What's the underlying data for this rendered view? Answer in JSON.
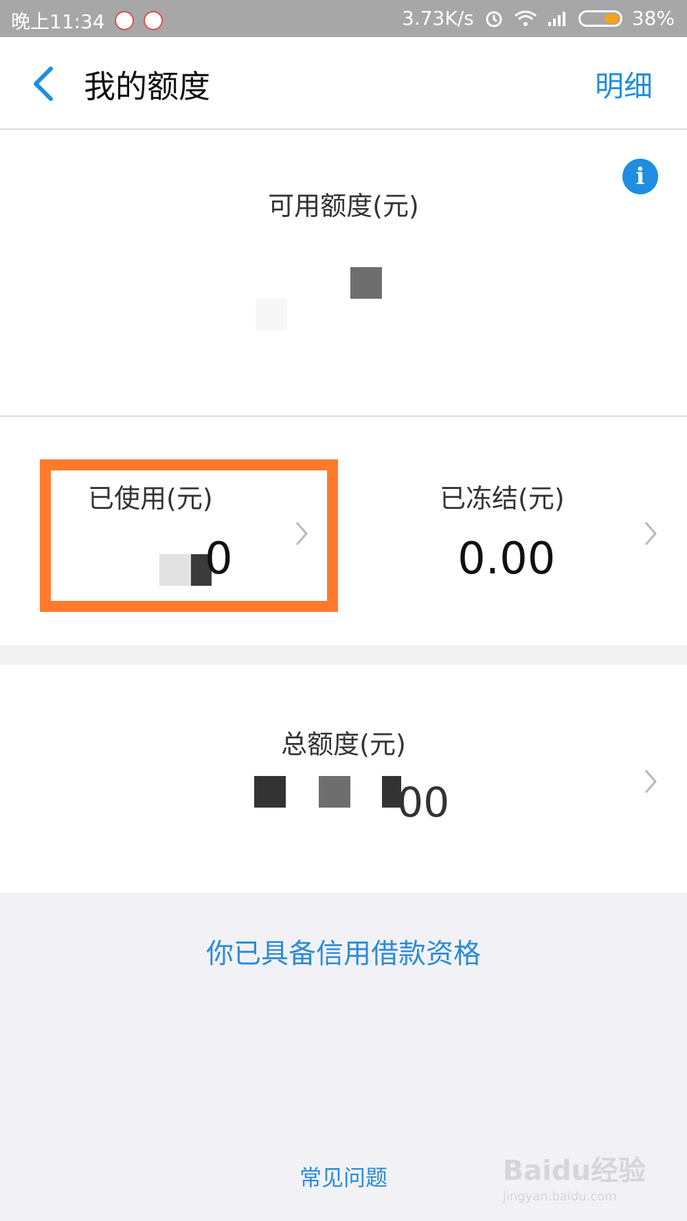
{
  "status_bar": {
    "time": "晚上11:34",
    "network_speed": "3.73K/s",
    "battery_percent": "38%",
    "battery_level": 0.38,
    "icons": [
      "alarm-icon",
      "wifi-icon",
      "signal-icon",
      "battery-icon"
    ]
  },
  "navbar": {
    "title": "我的额度",
    "action": "明细"
  },
  "available": {
    "label": "可用额度(元)",
    "value_obscured": true
  },
  "used": {
    "label": "已使用(元)",
    "value_visible_fragment": "0"
  },
  "frozen": {
    "label": "已冻结(元)",
    "value": "0.00"
  },
  "total": {
    "label": "总额度(元)",
    "value_visible_fragment": "00"
  },
  "eligibility_text": "你已具备信用借款资格",
  "faq_link": "常见问题",
  "watermark": {
    "brand": "Baidu经验",
    "url": "jingyan.baidu.com"
  },
  "colors": {
    "accent": "#1f8ee0",
    "highlight": "#ff7a2b",
    "statusbar": "#a7a7a7"
  }
}
